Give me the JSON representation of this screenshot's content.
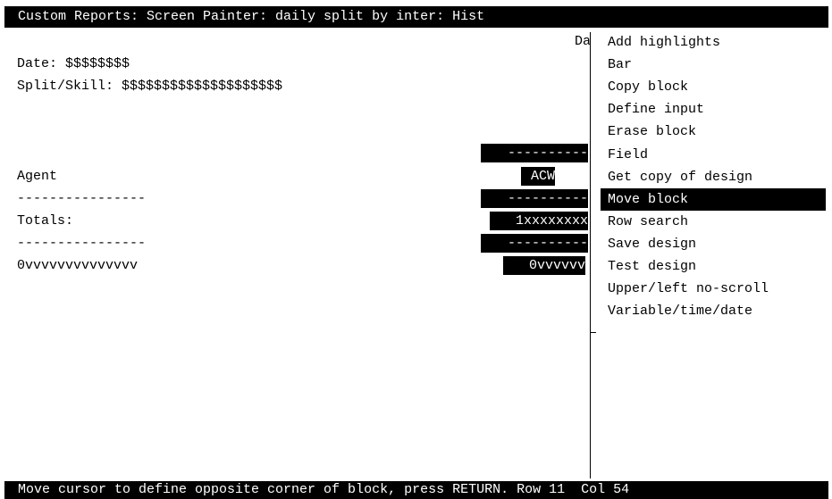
{
  "title": "Custom Reports: Screen Painter: daily split by inter: Hist",
  "status": "Move cursor to define opposite corner of block, press RETURN. Row 11  Col 54",
  "canvas": {
    "da_fragment": "Da",
    "date_line": "Date: $$$$$$$$",
    "split_line": "Split/Skill: $$$$$$$$$$$$$$$$$$$$",
    "agent_label": "Agent",
    "dashes_left_1": "----------------",
    "totals_label": "Totals:",
    "dashes_left_2": "----------------",
    "vvv_left": "0vvvvvvvvvvvvvv",
    "field_dashes_1": "----------",
    "field_acw": "ACW",
    "field_dashes_2": "----------",
    "field_xxx": "1xxxxxxxx",
    "field_dashes_3": "----------",
    "field_vvv": "0vvvvvv"
  },
  "menu": {
    "items": [
      {
        "label": "Add highlights",
        "selected": false
      },
      {
        "label": "Bar",
        "selected": false
      },
      {
        "label": "Copy block",
        "selected": false
      },
      {
        "label": "Define input",
        "selected": false
      },
      {
        "label": "Erase block",
        "selected": false
      },
      {
        "label": "Field",
        "selected": false
      },
      {
        "label": "Get copy of design",
        "selected": false
      },
      {
        "label": "Move block",
        "selected": true
      },
      {
        "label": "Row search",
        "selected": false
      },
      {
        "label": "Save design",
        "selected": false
      },
      {
        "label": "Test design",
        "selected": false
      },
      {
        "label": "Upper/left no-scroll",
        "selected": false
      },
      {
        "label": "Variable/time/date",
        "selected": false
      }
    ]
  }
}
